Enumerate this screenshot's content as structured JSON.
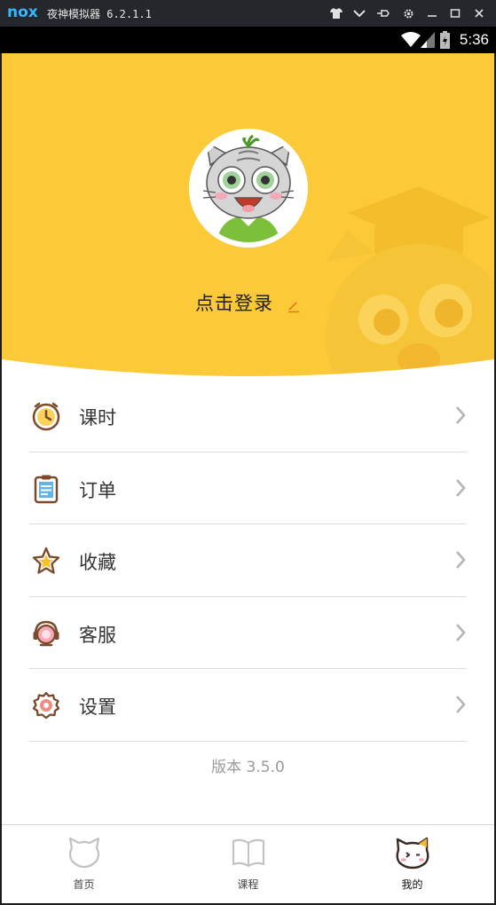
{
  "emulator": {
    "logo": "nox",
    "title": "夜神模拟器 6.2.1.1",
    "controls": [
      "shirt-icon",
      "chevron-down-icon",
      "pin-icon",
      "gear-icon",
      "minimize-icon",
      "maximize-icon",
      "close-icon"
    ]
  },
  "status_bar": {
    "time": "5:36"
  },
  "profile": {
    "login_label": "点击登录"
  },
  "menu": {
    "items": [
      {
        "label": "课时",
        "icon": "clock-icon"
      },
      {
        "label": "订单",
        "icon": "clipboard-icon"
      },
      {
        "label": "收藏",
        "icon": "star-icon"
      },
      {
        "label": "客服",
        "icon": "headset-icon"
      },
      {
        "label": "设置",
        "icon": "gear-icon"
      }
    ]
  },
  "version": "版本 3.5.0",
  "tabbar": {
    "tabs": [
      {
        "label": "首页",
        "icon": "cat-face-icon",
        "active": false
      },
      {
        "label": "课程",
        "icon": "book-icon",
        "active": false
      },
      {
        "label": "我的",
        "icon": "cat-profile-icon",
        "active": true
      }
    ]
  },
  "colors": {
    "header": "#fcc939",
    "accent": "#f2a324",
    "text": "#333333"
  }
}
